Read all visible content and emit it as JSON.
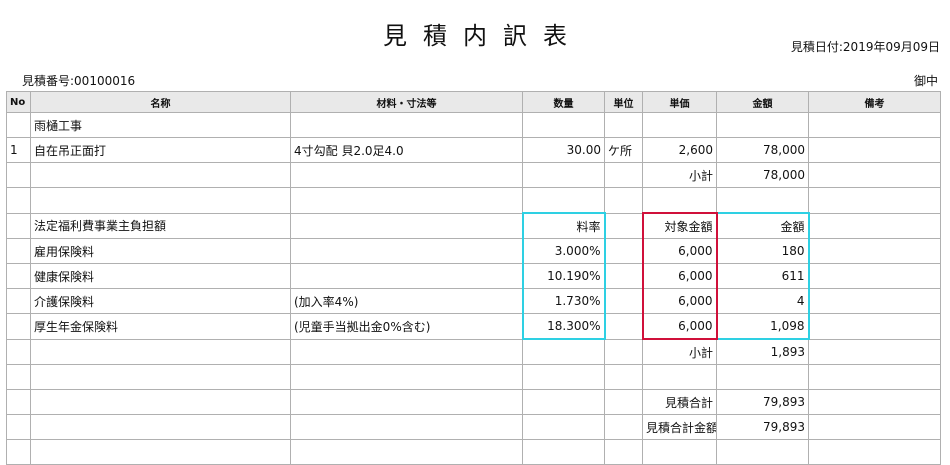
{
  "header": {
    "title": "見積内訳表",
    "date_label": "見積日付:2019年09月09日",
    "estimate_no": "見積番号:00100016",
    "honorific": "御中"
  },
  "columns": {
    "no": "No",
    "name": "名称",
    "spec": "材料・寸法等",
    "qty": "数量",
    "unit": "単位",
    "price": "単価",
    "amount": "金額",
    "note": "備考"
  },
  "section": {
    "title": "雨樋工事"
  },
  "item1": {
    "no": "1",
    "name": "自在吊正面打",
    "spec": "4寸勾配 貝2.0足4.0",
    "qty": "30.00",
    "unit": "ケ所",
    "price": "2,600",
    "amount": "78,000"
  },
  "subtotal1": {
    "label": "小計",
    "amount": "78,000"
  },
  "welfare": {
    "title": "法定福利費事業主負担額",
    "rate_header": "料率",
    "target_header": "対象金額",
    "amount_header": "金額",
    "rows": [
      {
        "name": "雇用保険料",
        "spec": "",
        "rate": "3.000%",
        "target": "6,000",
        "amount": "180"
      },
      {
        "name": "健康保険料",
        "spec": "",
        "rate": "10.190%",
        "target": "6,000",
        "amount": "611"
      },
      {
        "name": "介護保険料",
        "spec": "(加入率4%)",
        "rate": "1.730%",
        "target": "6,000",
        "amount": "4"
      },
      {
        "name": "厚生年金保険料",
        "spec": "(児童手当拠出金0%含む)",
        "rate": "18.300%",
        "target": "6,000",
        "amount": "1,098"
      }
    ]
  },
  "subtotal2": {
    "label": "小計",
    "amount": "1,893"
  },
  "total": {
    "label": "見積合計",
    "amount": "79,893"
  },
  "grand_total": {
    "label": "見積合計金額",
    "amount": "79,893"
  }
}
